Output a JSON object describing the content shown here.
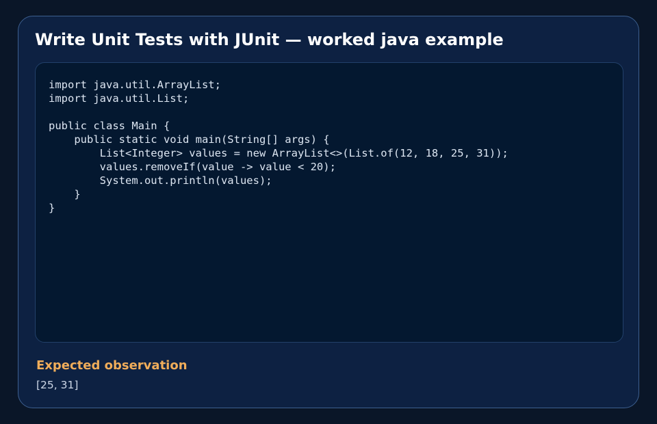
{
  "example": {
    "title": "Write Unit Tests with JUnit — worked java example",
    "code": "import java.util.ArrayList;\nimport java.util.List;\n\npublic class Main {\n    public static void main(String[] args) {\n        List<Integer> values = new ArrayList<>(List.of(12, 18, 25, 31));\n        values.removeIf(value -> value < 20);\n        System.out.println(values);\n    }\n}",
    "observation_heading": "Expected observation",
    "observation_value": "[25, 31]"
  },
  "colors": {
    "background": "#0a1628",
    "card": "#0d2142",
    "code_panel": "#041830",
    "heading_accent": "#f0ad5a"
  }
}
